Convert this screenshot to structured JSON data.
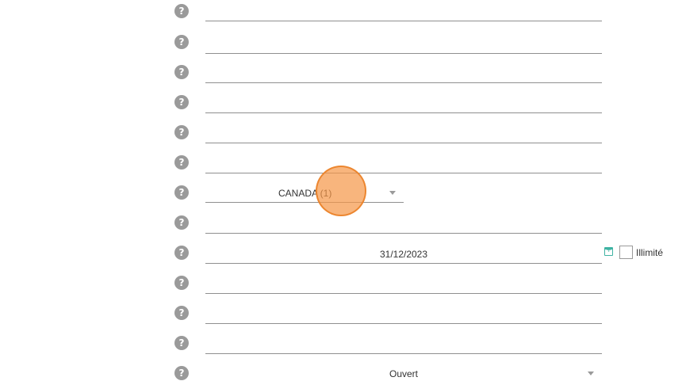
{
  "form": {
    "country_select": {
      "value": "CANADA (1)"
    },
    "date_field": {
      "value": "31/12/2023"
    },
    "unlimited_checkbox": {
      "label": "Illimité",
      "checked": false
    },
    "status_select": {
      "value": "Ouvert"
    }
  },
  "icons": {
    "help": "help-circle-icon",
    "calendar": "calendar-icon",
    "dropdown": "chevron-down-icon"
  },
  "colors": {
    "help_icon": "#9a9a9a",
    "calendar_accent": "#3fb3a3",
    "pointer_highlight": "#f5964b"
  }
}
